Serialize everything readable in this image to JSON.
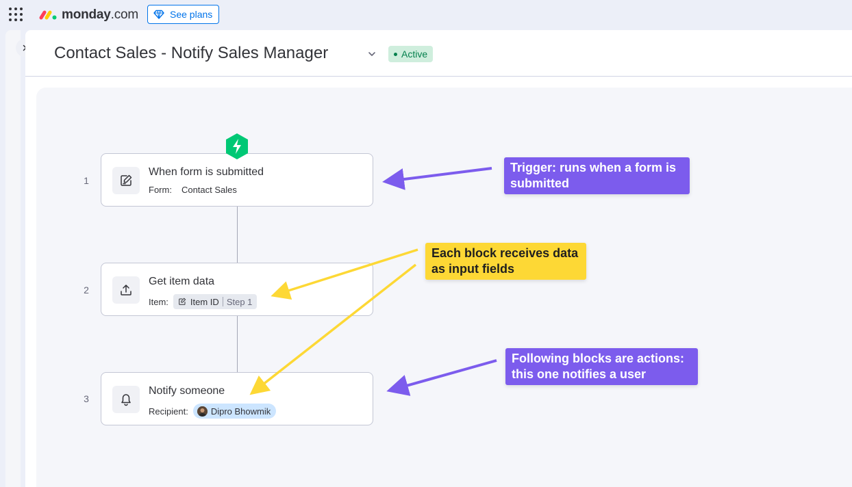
{
  "app": {
    "brand": "monday",
    "brand_suffix": ".com",
    "see_plans_label": "See plans"
  },
  "page": {
    "title": "Contact Sales - Notify Sales Manager",
    "status": "Active"
  },
  "steps": [
    {
      "number": "1",
      "title": "When form is submitted",
      "field_label": "Form:",
      "field_value": "Contact Sales",
      "icon": "form-edit-icon"
    },
    {
      "number": "2",
      "title": "Get item data",
      "field_label": "Item:",
      "chip_label": "Item ID",
      "chip_step": "Step 1",
      "icon": "upload-icon"
    },
    {
      "number": "3",
      "title": "Notify someone",
      "field_label": "Recipient:",
      "recipient": "Dipro Bhowmik",
      "icon": "bell-icon"
    }
  ],
  "callouts": {
    "trigger": "Trigger: runs when a form is submitted",
    "data": "Each block receives data as input fields",
    "actions": "Following blocks are actions: this one notifies a user"
  },
  "colors": {
    "accent_blue": "#0073ea",
    "active_green": "#037f4c",
    "trigger_green": "#00c875",
    "callout_purple": "#7c5ced",
    "callout_yellow": "#fdd835"
  }
}
